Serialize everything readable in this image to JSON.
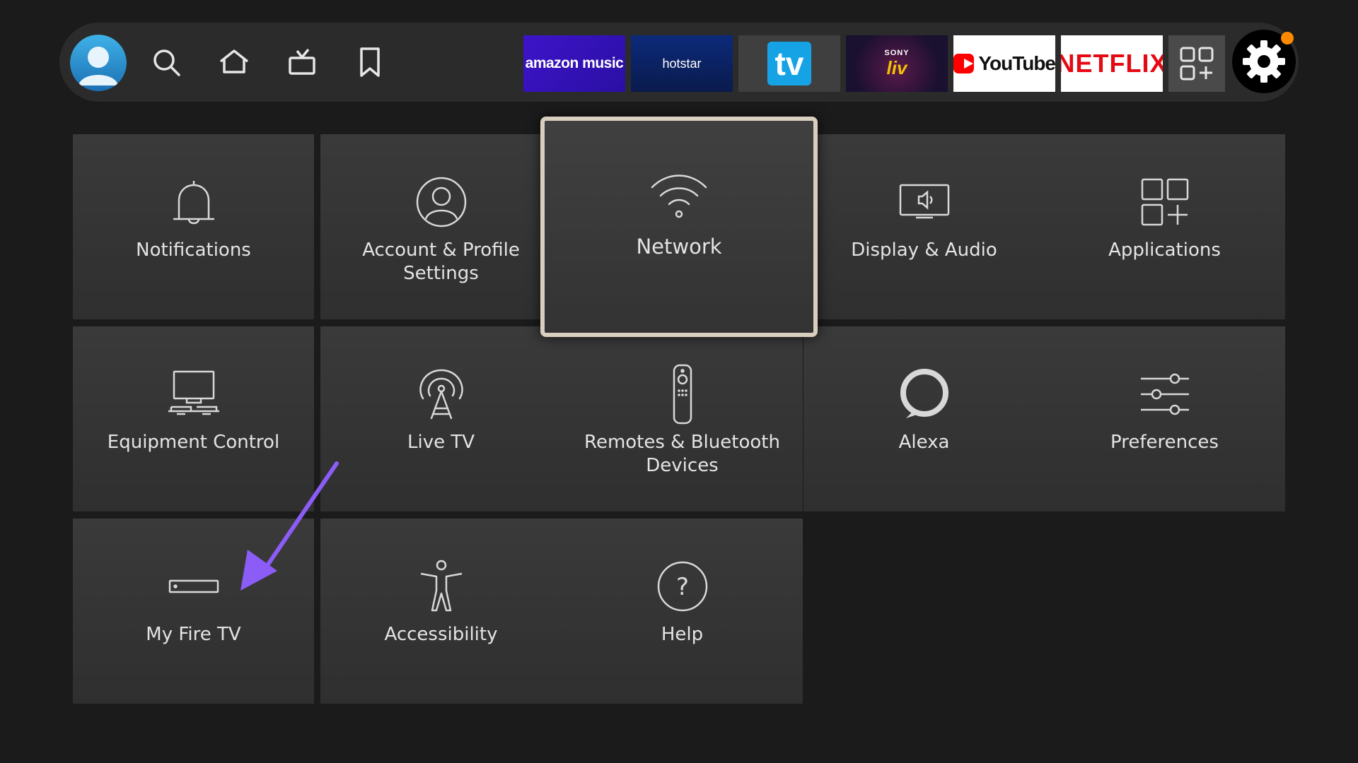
{
  "nav": {
    "profile_icon": "avatar-icon",
    "icons": [
      "search-icon",
      "home-icon",
      "live-tv-icon",
      "bookmark-icon"
    ],
    "apps": {
      "amazon_music": "amazon music",
      "hotstar": "hotstar",
      "tv": "tv",
      "sony_brand": "SONY",
      "sony_liv": "liv",
      "youtube": "YouTube",
      "netflix": "NETFLIX"
    },
    "settings_icon": "gear-icon",
    "notification_color": "#ff8a00"
  },
  "settings": {
    "notifications": "Notifications",
    "account": "Account & Profile Settings",
    "network": "Network",
    "display_audio": "Display & Audio",
    "applications": "Applications",
    "equipment": "Equipment Control",
    "live_tv": "Live TV",
    "remotes": "Remotes & Bluetooth Devices",
    "alexa": "Alexa",
    "preferences": "Preferences",
    "my_fire_tv": "My Fire TV",
    "accessibility": "Accessibility",
    "help": "Help"
  },
  "focused_item": "Network",
  "colors": {
    "background": "#1b1b1b",
    "tile": "#353535",
    "focus_border": "#d9cfbf",
    "arrow": "#8b5cf6"
  }
}
